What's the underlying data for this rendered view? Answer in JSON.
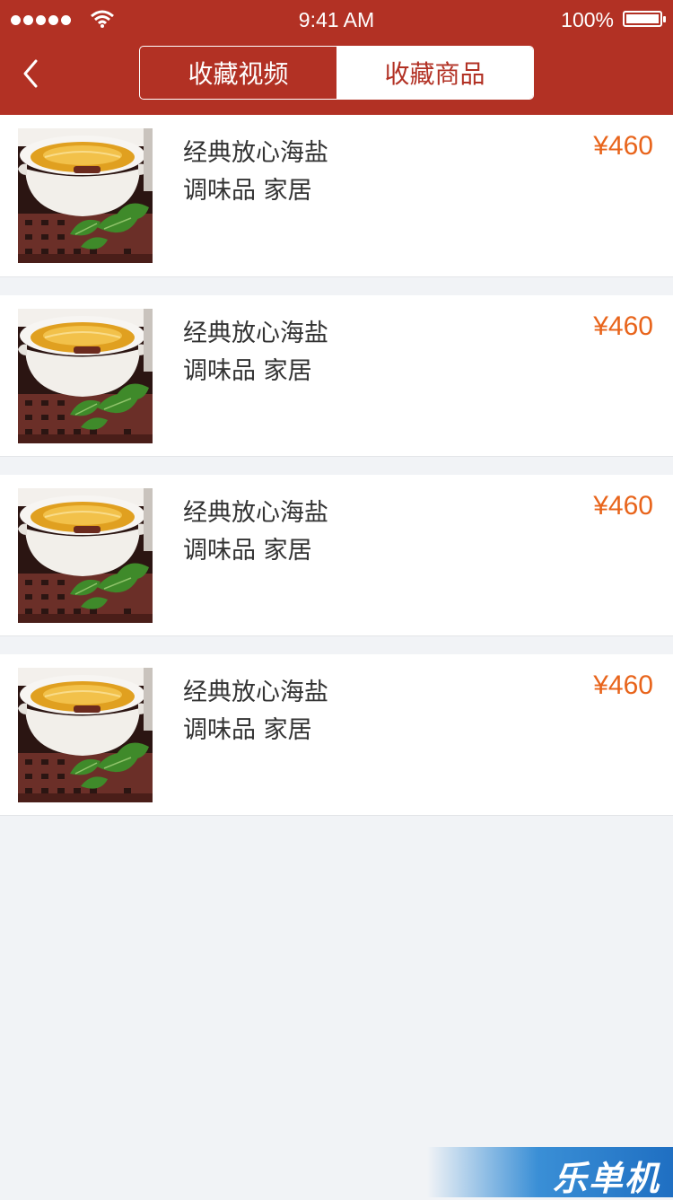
{
  "status_bar": {
    "time": "9:41 AM",
    "battery": "100%"
  },
  "nav": {
    "back_icon": "chevron-left-icon",
    "tabs": [
      {
        "label": "收藏视频",
        "active": false
      },
      {
        "label": "收藏商品",
        "active": true
      }
    ]
  },
  "products": [
    {
      "name": "经典放心海盐",
      "tags": "调味品 家居",
      "price": "¥460"
    },
    {
      "name": "经典放心海盐",
      "tags": "调味品 家居",
      "price": "¥460"
    },
    {
      "name": "经典放心海盐",
      "tags": "调味品 家居",
      "price": "¥460"
    },
    {
      "name": "经典放心海盐",
      "tags": "调味品 家居",
      "price": "¥460"
    }
  ],
  "watermark": "乐单机",
  "colors": {
    "header": "#b23124",
    "price": "#e8641b",
    "background": "#f1f3f6"
  }
}
